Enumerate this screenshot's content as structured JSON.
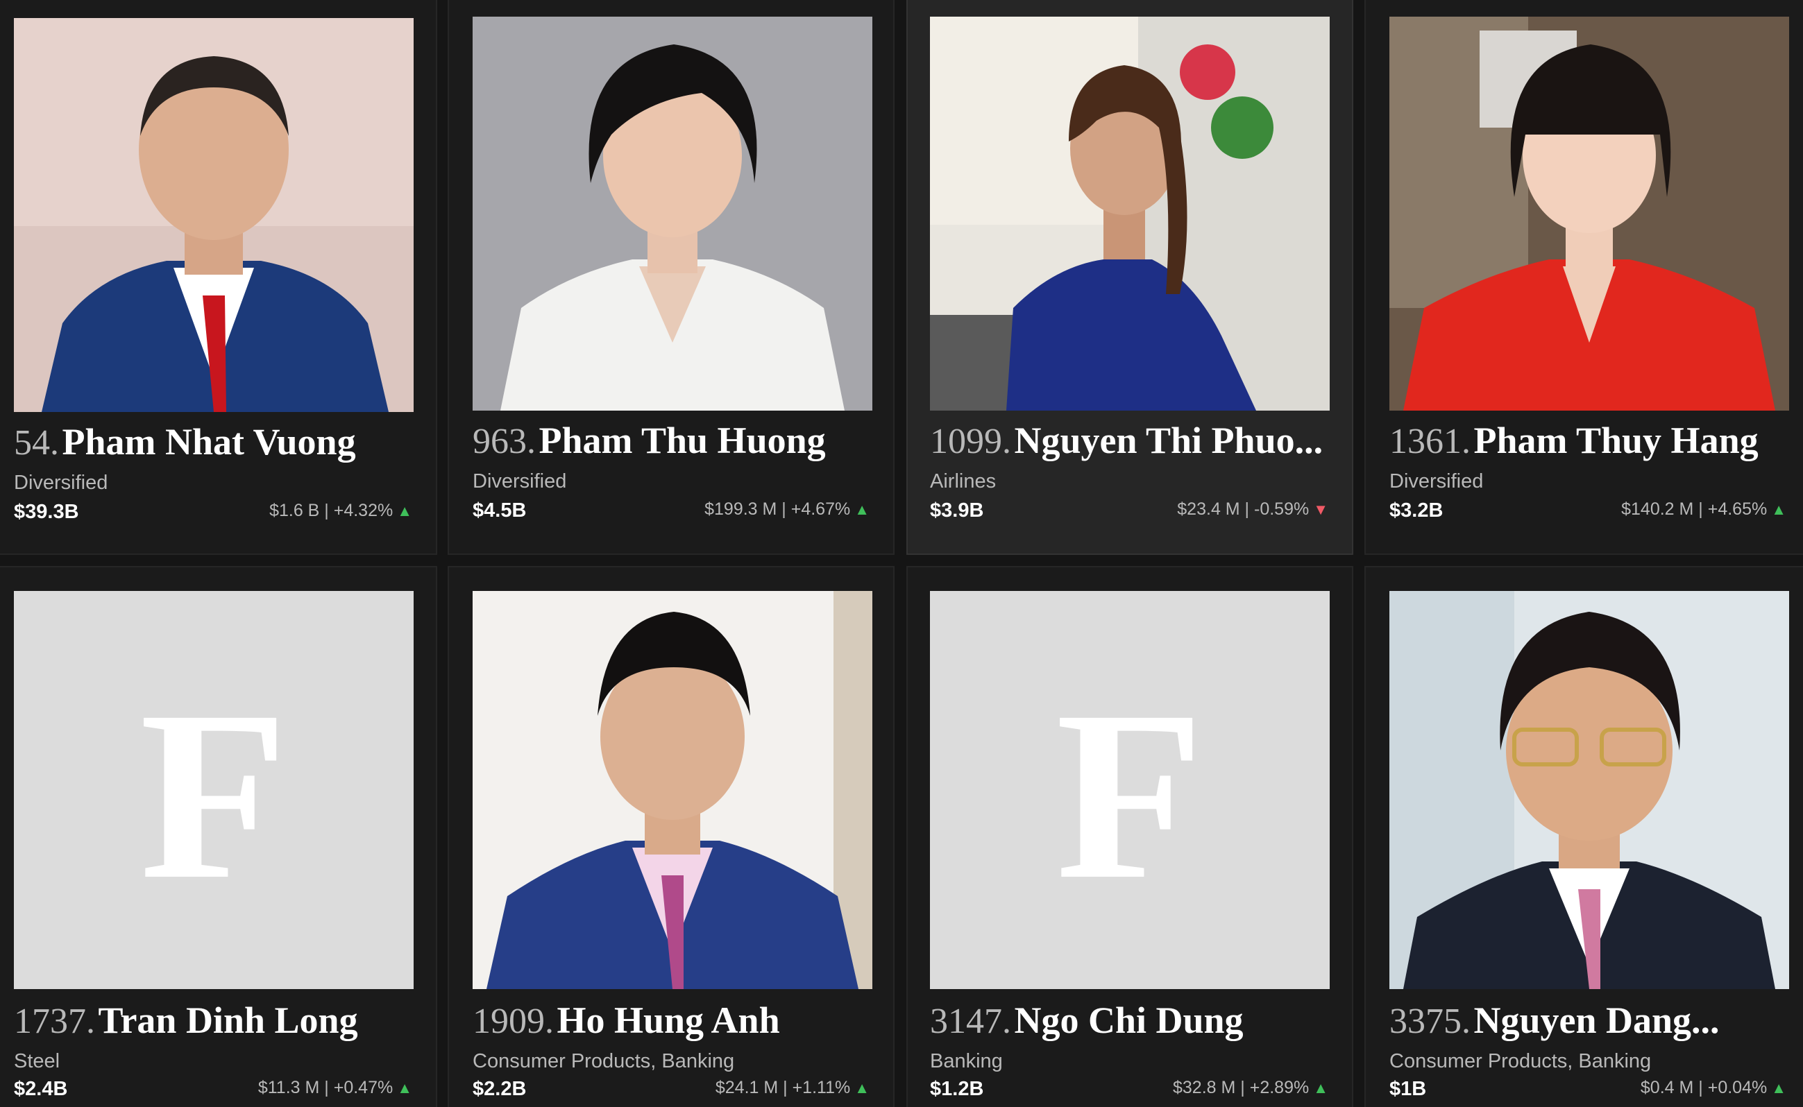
{
  "profiles": [
    {
      "rank": "54.",
      "name": "Pham Nhat Vuong",
      "industry": "Diversified",
      "net_worth": "$39.3B",
      "daily_change": "$1.6 B | +4.32%",
      "direction": "up",
      "arrow": "▲",
      "photo": "portrait-man-suit"
    },
    {
      "rank": "963.",
      "name": "Pham Thu Huong",
      "industry": "Diversified",
      "net_worth": "$4.5B",
      "daily_change": "$199.3 M | +4.67%",
      "direction": "up",
      "arrow": "▲",
      "photo": "portrait-woman-white-blazer"
    },
    {
      "rank": "1099.",
      "name": "Nguyen Thi Phuo...",
      "industry": "Airlines",
      "net_worth": "$3.9B",
      "daily_change": "$23.4 M | -0.59%",
      "direction": "down",
      "arrow": "▼",
      "photo": "portrait-woman-blue-dress"
    },
    {
      "rank": "1361.",
      "name": "Pham Thuy Hang",
      "industry": "Diversified",
      "net_worth": "$3.2B",
      "daily_change": "$140.2 M | +4.65%",
      "direction": "up",
      "arrow": "▲",
      "photo": "portrait-woman-red-top"
    },
    {
      "rank": "1737.",
      "name": "Tran Dinh Long",
      "industry": "Steel",
      "net_worth": "$2.4B",
      "daily_change": "$11.3 M | +0.47%",
      "direction": "up",
      "arrow": "▲",
      "photo": "placeholder-f-logo"
    },
    {
      "rank": "1909.",
      "name": "Ho Hung Anh",
      "industry": "Consumer Products, Banking",
      "net_worth": "$2.2B",
      "daily_change": "$24.1 M | +1.11%",
      "direction": "up",
      "arrow": "▲",
      "photo": "portrait-man-pink-tie"
    },
    {
      "rank": "3147.",
      "name": "Ngo Chi Dung",
      "industry": "Banking",
      "net_worth": "$1.2B",
      "daily_change": "$32.8 M | +2.89%",
      "direction": "up",
      "arrow": "▲",
      "photo": "placeholder-f-logo"
    },
    {
      "rank": "3375.",
      "name": "Nguyen Dang...",
      "industry": "Consumer Products, Banking",
      "net_worth": "$1B",
      "daily_change": "$0.4 M | +0.04%",
      "direction": "up",
      "arrow": "▲",
      "photo": "portrait-man-glasses"
    }
  ],
  "placeholder_letter": "F",
  "colors": {
    "background": "#151515",
    "card": "#1b1b1b",
    "card_highlight": "#262626",
    "up": "#3fbf5a",
    "down": "#f05a66",
    "muted_text": "#b9b9b9"
  }
}
